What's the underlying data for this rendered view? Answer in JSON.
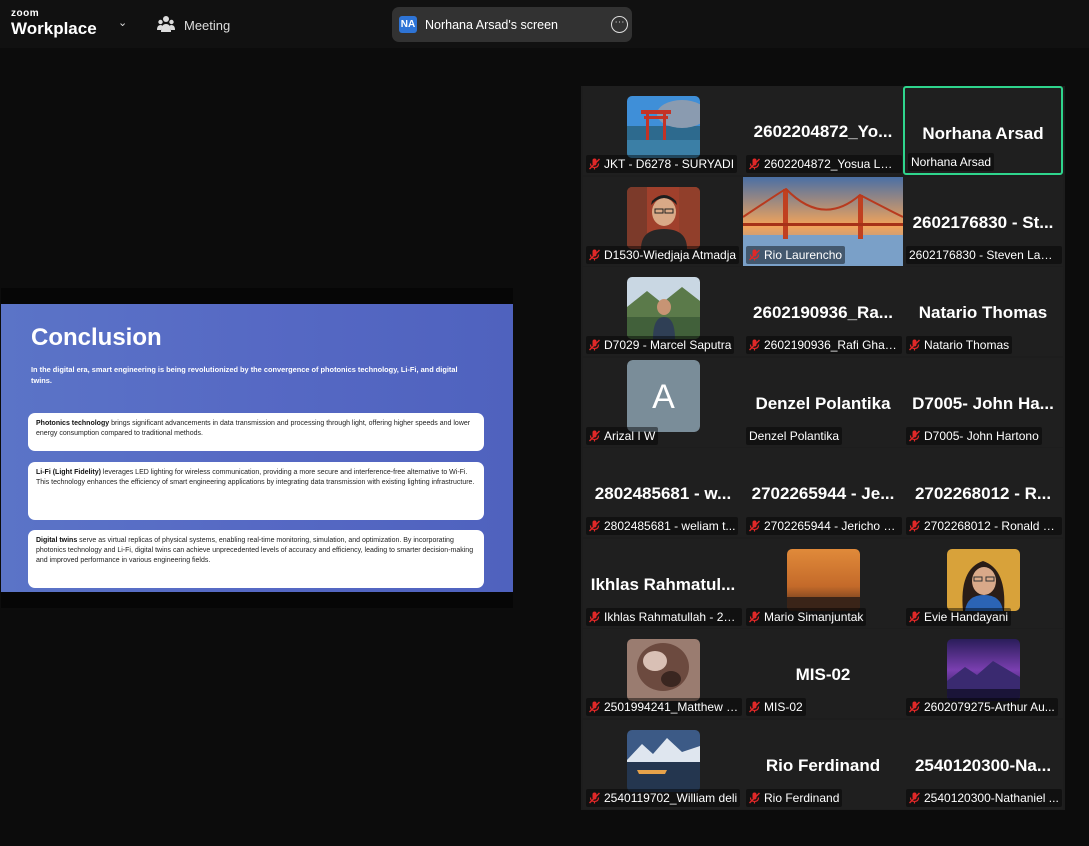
{
  "app": {
    "logo_line1": "zoom",
    "logo_line2": "Workplace",
    "chevron": "⌄"
  },
  "meeting": {
    "label": "Meeting"
  },
  "share": {
    "avatar_initials": "NA",
    "label": "Norhana Arsad's screen",
    "more": "⋯"
  },
  "slide": {
    "title": "Conclusion",
    "intro": "In the digital era, smart engineering is being revolutionized by the convergence of photonics technology, Li-Fi, and digital twins.",
    "cards": [
      {
        "bold": "Photonics technology",
        "text": " brings significant advancements in data transmission and processing through light, offering higher speeds and lower energy consumption compared to traditional methods."
      },
      {
        "bold": "Li-Fi (Light Fidelity)",
        "text": " leverages LED lighting for wireless communication, providing a more secure and interference-free alternative to Wi-Fi.",
        "text2": "This technology enhances the efficiency of smart engineering applications by integrating data transmission with existing lighting infrastructure."
      },
      {
        "bold": "Digital twins",
        "text": " serve as virtual replicas of physical systems, enabling real-time monitoring, simulation, and optimization. By incorporating photonics technology and Li-Fi, digital twins can achieve unprecedented levels of accuracy and efficiency, leading to smarter decision-making and improved performance in various engineering fields."
      }
    ]
  },
  "participants": [
    {
      "big": "",
      "name": "JKT - D6278 - SURYADI",
      "photo": "torii",
      "muted": true
    },
    {
      "big": "2602204872_Yo...",
      "name": "2602204872_Yosua Lum...",
      "muted": true
    },
    {
      "big": "Norhana Arsad",
      "name": "Norhana Arsad",
      "muted": false,
      "active": true
    },
    {
      "big": "",
      "name": "D1530-Wiedjaja Atmadja",
      "photo": "man",
      "muted": true
    },
    {
      "big": "",
      "name": "Rio Laurencho",
      "photo": "bridge",
      "muted": true
    },
    {
      "big": "2602176830 - St...",
      "name": "2602176830 - Steven Lawr...",
      "muted": false
    },
    {
      "big": "",
      "name": "D7029 - Marcel Saputra",
      "photo": "mountain",
      "muted": true
    },
    {
      "big": "2602190936_Ra...",
      "name": "2602190936_Rafi Ghazi B",
      "muted": true
    },
    {
      "big": "Natario Thomas",
      "name": "Natario Thomas",
      "muted": true
    },
    {
      "big": "",
      "name": "Arizal I W",
      "photo": "avatarA",
      "avatar_letter": "A",
      "muted": true
    },
    {
      "big": "Denzel Polantika",
      "name": "Denzel Polantika",
      "muted": false
    },
    {
      "big": "D7005- John Ha...",
      "name": "D7005- John Hartono",
      "muted": true
    },
    {
      "big": "2802485681 - w...",
      "name": "2802485681 - weliam t...",
      "muted": true
    },
    {
      "big": "2702265944 - Je...",
      "name": "2702265944 - Jericho J...",
      "muted": true
    },
    {
      "big": "2702268012 - R...",
      "name": "2702268012 - Ronald C...",
      "muted": true
    },
    {
      "big": "Ikhlas  Rahmatul...",
      "name": "Ikhlas Rahmatullah - 27...",
      "muted": true
    },
    {
      "big": "",
      "name": "Mario Simanjuntak",
      "photo": "sunset",
      "muted": true
    },
    {
      "big": "",
      "name": "Evie Handayani",
      "photo": "woman",
      "muted": true
    },
    {
      "big": "",
      "name": "2501994241_Matthew F...",
      "photo": "blurry",
      "muted": true
    },
    {
      "big": "MIS-02",
      "name": "MIS-02",
      "muted": true
    },
    {
      "big": "",
      "name": "2602079275-Arthur Au...",
      "photo": "purple",
      "muted": true
    },
    {
      "big": "",
      "name": "2540119702_William deli",
      "photo": "lake",
      "muted": true
    },
    {
      "big": "Rio Ferdinand",
      "name": "Rio Ferdinand",
      "muted": true
    },
    {
      "big": "2540120300-Na...",
      "name": "2540120300-Nathaniel ...",
      "muted": true
    }
  ]
}
